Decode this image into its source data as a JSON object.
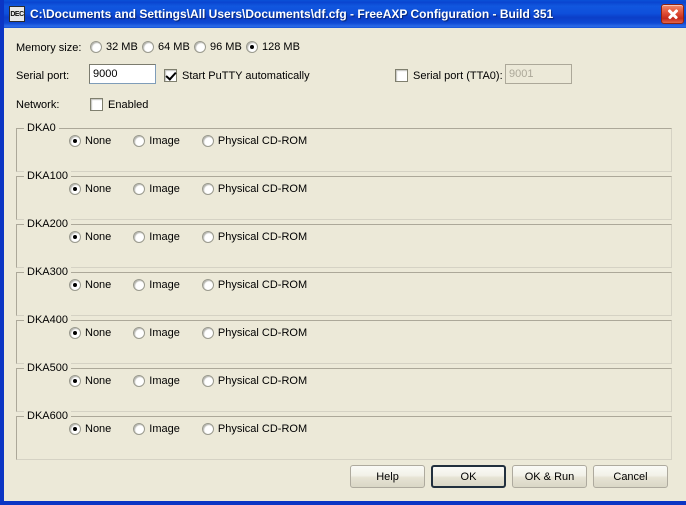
{
  "window": {
    "title": "C:\\Documents and Settings\\All Users\\Documents\\df.cfg - FreeAXP Configuration - Build 351",
    "icon_text": "DEC",
    "close_icon": "close-icon",
    "background_color": "#ECE9D8",
    "titlebar_color": "#0A4AD4"
  },
  "memory": {
    "label": "Memory size:",
    "options": [
      {
        "label": "32 MB",
        "selected": false
      },
      {
        "label": "64 MB",
        "selected": false
      },
      {
        "label": "96 MB",
        "selected": false
      },
      {
        "label": "128 MB",
        "selected": true
      }
    ]
  },
  "serial": {
    "label": "Serial port:",
    "value": "9000",
    "putty": {
      "label": "Start PuTTY automatically",
      "checked": true
    },
    "tta0": {
      "label": "Serial port (TTA0):",
      "checked": false,
      "value": "9001",
      "disabled": true
    }
  },
  "network": {
    "label": "Network:",
    "enabled": {
      "label": "Enabled",
      "checked": false
    }
  },
  "device_option_labels": [
    "None",
    "Image",
    "Physical CD-ROM"
  ],
  "devices": [
    {
      "name": "DKA0",
      "selected": "None"
    },
    {
      "name": "DKA100",
      "selected": "None"
    },
    {
      "name": "DKA200",
      "selected": "None"
    },
    {
      "name": "DKA300",
      "selected": "None"
    },
    {
      "name": "DKA400",
      "selected": "None"
    },
    {
      "name": "DKA500",
      "selected": "None"
    },
    {
      "name": "DKA600",
      "selected": "None"
    }
  ],
  "buttons": {
    "help": "Help",
    "ok": "OK",
    "ok_run": "OK & Run",
    "cancel": "Cancel"
  }
}
